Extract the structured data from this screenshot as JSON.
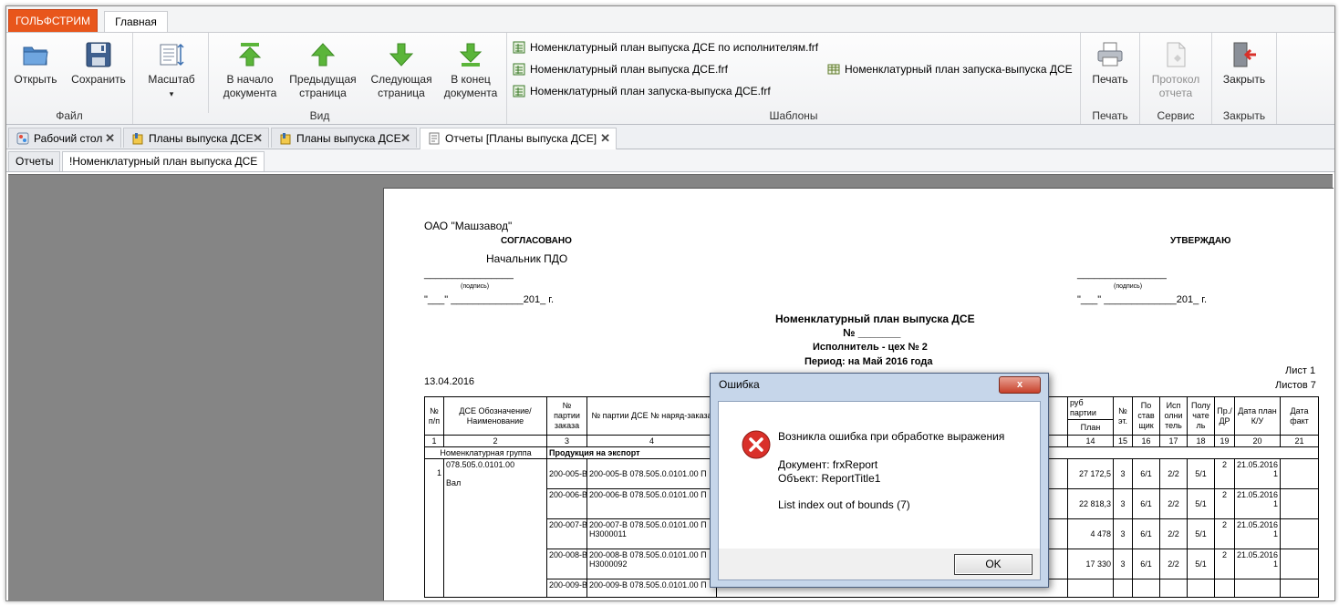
{
  "app": {
    "app_tab": "ГОЛЬФСТРИМ",
    "main_tab": "Главная"
  },
  "ribbon": {
    "file": {
      "open": "Открыть",
      "save": "Сохранить",
      "label": "Файл"
    },
    "view": {
      "scale": "Масштаб",
      "first_l1": "В начало",
      "first_l2": "документа",
      "prev_l1": "Предыдущая",
      "prev_l2": "страница",
      "next_l1": "Следующая",
      "next_l2": "страница",
      "last_l1": "В конец",
      "last_l2": "документа",
      "label": "Вид"
    },
    "templates": {
      "items": [
        "Номенклатурный план выпуска ДСЕ по исполнителям.frf",
        "Номенклатурный план выпуска ДСЕ.frf",
        "Номенклатурный план запуска-выпуска ДСЕ.frf",
        "Номенклатурный план запуска-выпуска ДСЕ"
      ],
      "label": "Шаблоны"
    },
    "print": {
      "print": "Печать",
      "label": "Печать"
    },
    "service": {
      "protocol_l1": "Протокол",
      "protocol_l2": "отчета",
      "label": "Сервис"
    },
    "close": {
      "close": "Закрыть",
      "label": "Закрыть"
    }
  },
  "doc_tabs": [
    "Рабочий стол",
    "Планы выпуска ДСЕ",
    "Планы выпуска ДСЕ",
    "Отчеты  [Планы выпуска ДСЕ]"
  ],
  "sub_tabs": [
    "Отчеты",
    "!Номенклатурный план выпуска ДСЕ"
  ],
  "report": {
    "org": "ОАО \"Машзавод\"",
    "agreed": "СОГЛАСОВАНО",
    "agreed_by": "Начальник ПДО",
    "approve": "УТВЕРЖДАЮ",
    "sign_hint": "(подпись)",
    "date_tpl": "\"___\" _____________201_ г.",
    "sign_line": "________________",
    "title": "Номенклатурный план выпуска ДСЕ",
    "number": "№ _______",
    "executor": "Исполнитель - цех № 2",
    "period": "Период:  на Май 2016 года",
    "date": "13.04.2016",
    "sheet": "Лист 1",
    "sheets": "Листов 7",
    "headers": {
      "n": "№ п/п",
      "dse": "ДСЕ Обозначение/ Наименование",
      "party": "№ партии заказа",
      "party_dse": "№ партии ДСЕ № наряд-заказа",
      "rub": "руб",
      "party_col": "партии",
      "plan": "План",
      "et": "№ эт.",
      "supplier": "По став щик",
      "executor": "Исп олни тель",
      "receiver": "Полу чате ль",
      "pr": "Пр./ ДР",
      "date_plan": "Дата план К/У",
      "date_fact": "Дата факт"
    },
    "col_numbers": [
      "1",
      "2",
      "3",
      "4",
      "14",
      "15",
      "16",
      "17",
      "18",
      "19",
      "20",
      "21"
    ],
    "group_label": "Номенклатурная группа",
    "group_value": "Продукция на экспорт",
    "item_no": "1",
    "item_code": "078.505.0.0101.00",
    "item_name": "Вал",
    "rows": [
      {
        "party": "200-005-В",
        "party_dse": "200-005-В 078.505.0.0101.00 П",
        "plan": "27 172,5",
        "et": "3",
        "sup": "6/1",
        "exe": "2/2",
        "rec": "5/1",
        "pr": "2",
        "date": "21.05.2016",
        "date2": "1"
      },
      {
        "party": "200-006-В",
        "party_dse": "200-006-В 078.505.0.0101.00 П",
        "plan": "22 818,3",
        "et": "3",
        "sup": "6/1",
        "exe": "2/2",
        "rec": "5/1",
        "pr": "2",
        "date": "21.05.2016",
        "date2": "1"
      },
      {
        "party": "200-007-В",
        "party_dse": "200-007-В 078.505.0.0101.00 П Н3000011",
        "plan": "4 478",
        "et": "3",
        "sup": "6/1",
        "exe": "2/2",
        "rec": "5/1",
        "pr": "2",
        "date": "21.05.2016",
        "date2": "1"
      },
      {
        "party": "200-008-В",
        "party_dse": "200-008-В 078.505.0.0101.00 П Н3000092",
        "plan": "17 330",
        "et": "3",
        "sup": "6/1",
        "exe": "2/2",
        "rec": "5/1",
        "pr": "2",
        "date": "21.05.2016",
        "date2": "1"
      },
      {
        "party": "200-009-В",
        "party_dse": "200-009-В 078.505.0.0101.00 П",
        "plan": "",
        "et": "",
        "sup": "",
        "exe": "",
        "rec": "",
        "pr": "",
        "date": "",
        "date2": ""
      }
    ]
  },
  "dialog": {
    "title": "Ошибка",
    "line1": "Возникла ошибка при обработке выражения",
    "line2": "Документ: frxReport",
    "line3": "Объект: ReportTitle1",
    "line4": "List index out of bounds (7)",
    "ok": "OK",
    "close": "x"
  },
  "colors": {
    "app_tab": "#e8561b",
    "ribbon_bg": "#f0f1f3",
    "viewer_bg": "#858585",
    "green_arrow": "#5bb53a",
    "error_red": "#d9302a"
  }
}
